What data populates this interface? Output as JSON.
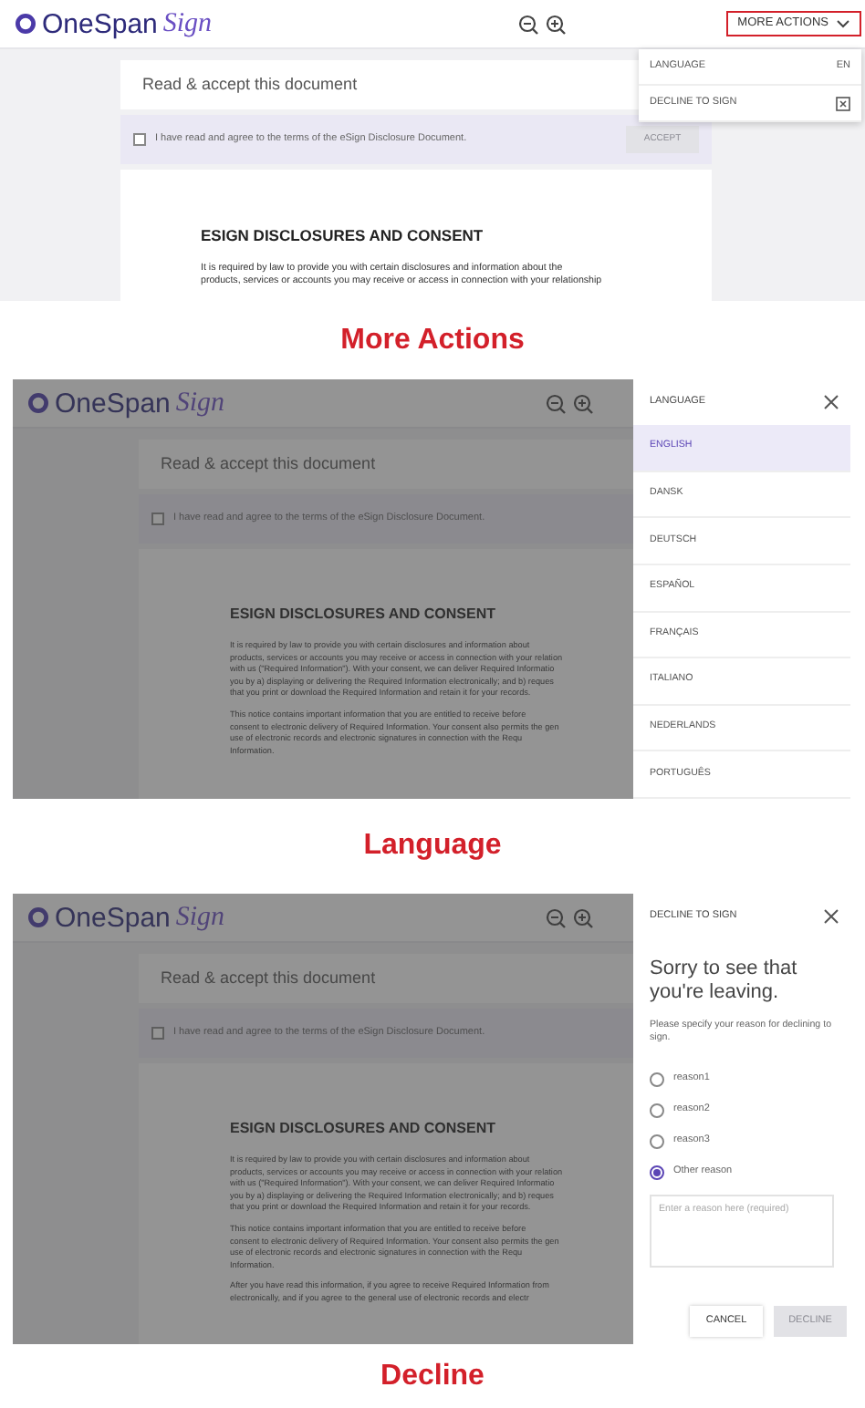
{
  "screens": [
    {
      "kind": "more_actions",
      "caption": "More Actions",
      "dimmed": false,
      "header": {
        "logo": "OneSpan",
        "logo_script": "Sign",
        "actions_button": "MORE ACTIONS"
      },
      "document": {
        "title": "Read & accept this document",
        "agreement": "I have read and agree to the terms of the eSign Disclosure Document.",
        "agreed": false,
        "accept_button": "ACCEPT",
        "heading": "ESIGN DISCLOSURES AND CONSENT",
        "paragraphs": [
          [
            "It is required by law to provide you with certain disclosures and information about the",
            "products, services or accounts you may receive or access in connection with your relationship"
          ]
        ]
      },
      "menu": [
        {
          "kind": "value",
          "label": "LANGUAGE",
          "value": "EN"
        },
        {
          "kind": "icon",
          "label": "DECLINE TO SIGN"
        }
      ]
    },
    {
      "kind": "language",
      "caption": "Language",
      "dimmed": true,
      "header": {
        "logo": "OneSpan",
        "logo_script": "Sign"
      },
      "document": {
        "title": "Read & accept this document",
        "agreement": "I have read and agree to the terms of the eSign Disclosure Document.",
        "agreed": false,
        "heading": "ESIGN DISCLOSURES AND CONSENT",
        "paragraphs": [
          [
            "It is required by law to provide you with certain disclosures and information about",
            "products, services or accounts you may receive or access in connection with your relation",
            "with us (\"Required Information\"). With your consent, we can deliver Required Informatio",
            "you by a) displaying or delivering the Required Information electronically; and b) reques",
            "that you print or download the Required Information and retain it for your records."
          ],
          [
            "This notice contains important information that you are entitled to receive before",
            "consent to electronic delivery of Required Information. Your consent also permits the gen",
            "use of electronic records and electronic signatures in connection with the Requ",
            "Information."
          ]
        ]
      },
      "side_panel": {
        "kind": "language",
        "title": "LANGUAGE",
        "options": [
          {
            "label": "ENGLISH",
            "selected": true
          },
          {
            "label": "DANSK",
            "selected": false
          },
          {
            "label": "DEUTSCH",
            "selected": false
          },
          {
            "label": "ESPAÑOL",
            "selected": false
          },
          {
            "label": "FRANÇAIS",
            "selected": false
          },
          {
            "label": "ITALIANO",
            "selected": false
          },
          {
            "label": "NEDERLANDS",
            "selected": false
          },
          {
            "label": "PORTUGUÊS",
            "selected": false
          }
        ]
      }
    },
    {
      "kind": "decline",
      "caption": "Decline",
      "dimmed": true,
      "header": {
        "logo": "OneSpan",
        "logo_script": "Sign"
      },
      "document": {
        "title": "Read & accept this document",
        "agreement": "I have read and agree to the terms of the eSign Disclosure Document.",
        "agreed": false,
        "heading": "ESIGN DISCLOSURES AND CONSENT",
        "paragraphs": [
          [
            "It is required by law to provide you with certain disclosures and information about",
            "products, services or accounts you may receive or access in connection with your relation",
            "with us (\"Required Information\"). With your consent, we can deliver Required Informatio",
            "you by a) displaying or delivering the Required Information electronically; and b) reques",
            "that you print or download the Required Information and retain it for your records."
          ],
          [
            "This notice contains important information that you are entitled to receive before",
            "consent to electronic delivery of Required Information. Your consent also permits the gen",
            "use of electronic records and electronic signatures in connection with the Requ",
            "Information."
          ],
          [
            "After you have read this information, if you agree to receive Required Information from",
            "electronically, and if you agree to the general use of electronic records and electr"
          ]
        ]
      },
      "side_panel": {
        "kind": "decline",
        "title": "DECLINE TO SIGN",
        "heading": "Sorry to see that you're leaving.",
        "prompt": "Please specify your reason for declining to sign.",
        "reasons": [
          {
            "label": "reason1",
            "selected": false
          },
          {
            "label": "reason2",
            "selected": false
          },
          {
            "label": "reason3",
            "selected": false
          },
          {
            "label": "Other reason",
            "selected": true
          }
        ],
        "reason_field": {
          "placeholder": "Enter a reason here (required)"
        },
        "buttons": [
          {
            "label": "CANCEL",
            "disabled": false
          },
          {
            "label": "DECLINE",
            "disabled": true
          }
        ]
      }
    }
  ]
}
